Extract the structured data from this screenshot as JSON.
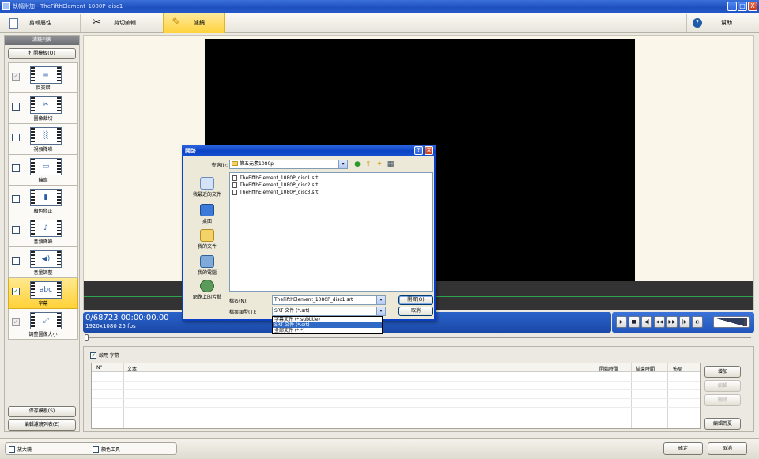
{
  "window": {
    "title": "執幅附加 - TheFifthElement_1080P_disc1 -",
    "controls": {
      "minimize": "_",
      "maximize": "□",
      "close": "X"
    }
  },
  "toolbar": {
    "project_props": "剪輯屬性",
    "clip_editor": "剪切編輯",
    "filters": "濾鏡",
    "help": "幫助..."
  },
  "left_panel": {
    "header": "濾鏡列表",
    "open_template": "打開模板(O)",
    "filters": [
      {
        "label": "反交錯",
        "checked": true,
        "dim": true
      },
      {
        "label": "圖像裁切",
        "checked": false,
        "dim": false
      },
      {
        "label": "視頻降噪",
        "checked": false,
        "dim": false
      },
      {
        "label": "輪廓",
        "checked": false,
        "dim": false
      },
      {
        "label": "顏色修正",
        "checked": false,
        "dim": false
      },
      {
        "label": "音頻降噪",
        "checked": false,
        "dim": false
      },
      {
        "label": "音量調整",
        "checked": false,
        "dim": false
      },
      {
        "label": "字幕",
        "checked": true,
        "dim": false,
        "selected": true
      },
      {
        "label": "調整圖像大小",
        "checked": true,
        "dim": true
      }
    ],
    "save_template": "保存模板(S)",
    "edit_filter_list": "編輯濾鏡列表(E)"
  },
  "player": {
    "timecode": "0/68723  00:00:00.00",
    "resolution": "1920x1080 25  fps"
  },
  "subtitles": {
    "enable_label": "啟用 字幕",
    "enabled": true,
    "columns": {
      "num": "N°",
      "text": "文本",
      "start": "開始時間",
      "end": "結束時間",
      "layout": "佈局"
    },
    "buttons": {
      "add": "增加",
      "edit": "編輯",
      "delete": "刪除",
      "edit_style": "編輯荒夏"
    }
  },
  "statusbar": {
    "magnifier": "放大鏡",
    "color_tool": "顏色工具",
    "ok": "確定",
    "cancel": "取消"
  },
  "dialog": {
    "title": "開啓",
    "help_btn": "?",
    "close_btn": "X",
    "look_in_label": "查詢(I):",
    "look_in_value": "第五元素1080p",
    "places": [
      "我最近的文件",
      "桌面",
      "我的文件",
      "我的電腦",
      "網路上的芳鄰"
    ],
    "files": [
      "TheFifthElement_1080P_disc1.srt",
      "TheFifthElement_1080P_disc2.srt",
      "TheFifthElement_1080P_disc3.srt"
    ],
    "filename_label": "檔名(N):",
    "filename_value": "TheFifthElement_1080P_disc1.srt",
    "filetype_label": "檔案類型(T):",
    "filetype_value": "SRT 文件 (*.srt)",
    "filetype_options": [
      "字幕文件 (*.subtitle)",
      "SRT 文件 (*.srt)",
      "全部文件 (*.*)"
    ],
    "open_btn": "開啓(O)",
    "cancel_btn": "取消"
  }
}
